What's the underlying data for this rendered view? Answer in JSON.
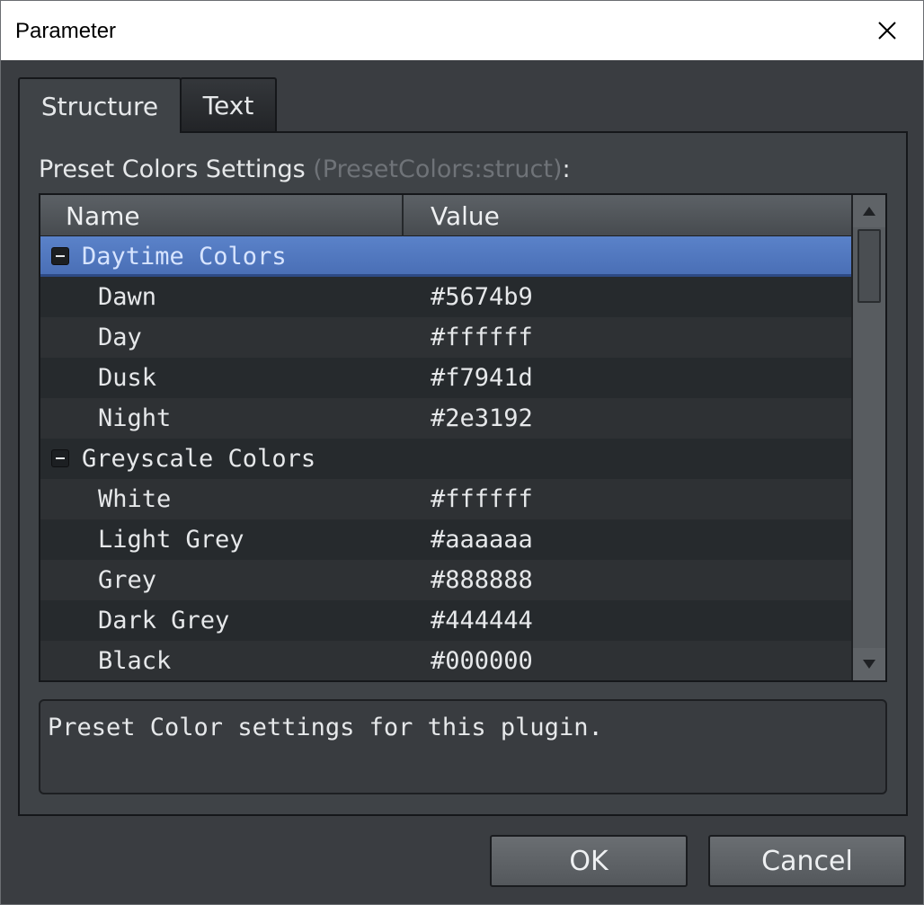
{
  "window": {
    "title": "Parameter"
  },
  "icons": {
    "close": "close-icon",
    "collapse": "minus-box-icon",
    "scroll_up": "triangle-up-icon",
    "scroll_down": "triangle-down-icon"
  },
  "tabs": [
    {
      "label": "Structure",
      "active": true
    },
    {
      "label": "Text",
      "active": false
    }
  ],
  "section": {
    "label": "Preset Colors Settings",
    "hint": "(PresetColors:struct)",
    "suffix": ":"
  },
  "tree": {
    "columns": {
      "name": "Name",
      "value": "Value"
    },
    "groups": [
      {
        "label": "Daytime Colors",
        "expanded": true,
        "selected": true,
        "items": [
          {
            "name": "Dawn",
            "value": "#5674b9"
          },
          {
            "name": "Day",
            "value": "#ffffff"
          },
          {
            "name": "Dusk",
            "value": "#f7941d"
          },
          {
            "name": "Night",
            "value": "#2e3192"
          }
        ]
      },
      {
        "label": "Greyscale Colors",
        "expanded": true,
        "selected": false,
        "items": [
          {
            "name": "White",
            "value": "#ffffff"
          },
          {
            "name": "Light Grey",
            "value": "#aaaaaa"
          },
          {
            "name": "Grey",
            "value": "#888888"
          },
          {
            "name": "Dark Grey",
            "value": "#444444"
          },
          {
            "name": "Black",
            "value": "#000000"
          }
        ]
      }
    ]
  },
  "description": "Preset Color settings for this plugin.",
  "buttons": {
    "ok": "OK",
    "cancel": "Cancel"
  },
  "colors": {
    "selection": "#5a82c9",
    "background": "#3a3d41",
    "panel": "#3f4347"
  }
}
